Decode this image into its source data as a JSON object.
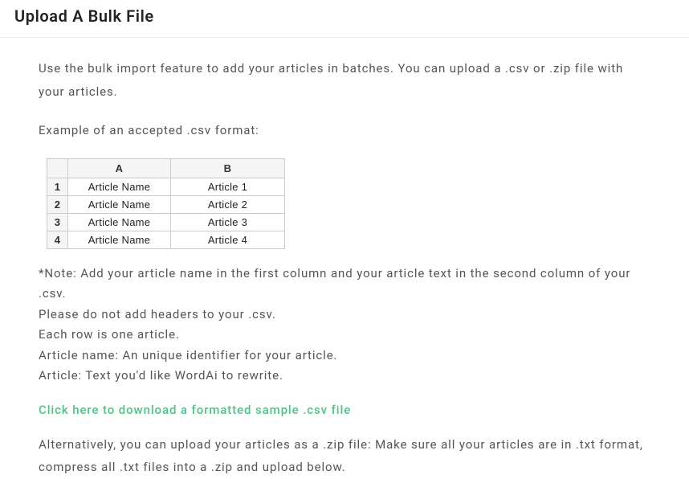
{
  "header": {
    "title": "Upload A Bulk File"
  },
  "intro": "Use the bulk import feature to add your articles in batches. You can upload a .csv or .zip file with your articles.",
  "exampleLabel": "Example of an accepted .csv format:",
  "table": {
    "colA": "A",
    "colB": "B",
    "rows": [
      {
        "n": "1",
        "a": "Article Name",
        "b": "Article 1"
      },
      {
        "n": "2",
        "a": "Article Name",
        "b": "Article 2"
      },
      {
        "n": "3",
        "a": "Article Name",
        "b": "Article 3"
      },
      {
        "n": "4",
        "a": "Article Name",
        "b": "Article 4"
      }
    ]
  },
  "notes": {
    "line1": "*Note: Add your article name in the first column and your article text in the second column of your .csv.",
    "line2": "Please do not add headers to your .csv.",
    "line3": "Each row is one article.",
    "line4": "Article name: An unique identifier for your article.",
    "line5": "Article: Text you'd like WordAi to rewrite."
  },
  "downloadLink": "Click here to download a formatted sample .csv file",
  "altText": "Alternatively, you can upload your articles as a .zip file: Make sure all your articles are in .txt format, compress all .txt files into a .zip and upload below."
}
